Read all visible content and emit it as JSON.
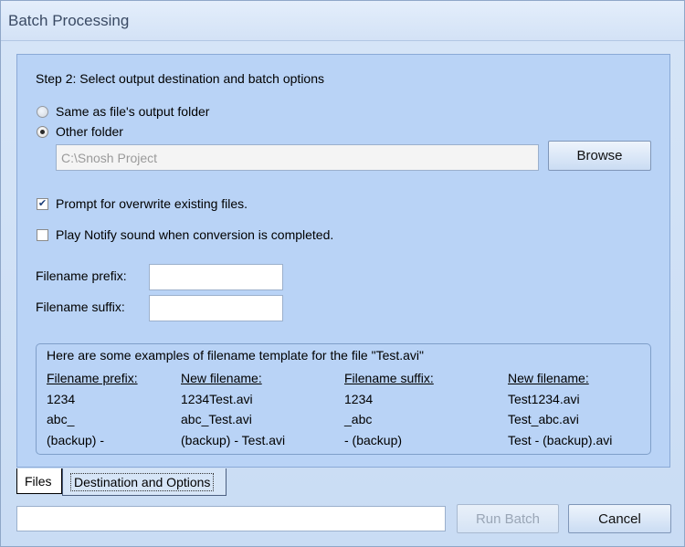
{
  "window": {
    "title": "Batch Processing"
  },
  "step_label": "Step 2: Select output destination and  batch options",
  "output": {
    "same_label": "Same as file's output folder",
    "other_label": "Other folder",
    "path_value": "C:\\Snosh Project",
    "browse_label": "Browse"
  },
  "options": {
    "prompt_overwrite_label": "Prompt for overwrite existing files.",
    "prompt_overwrite_checked": true,
    "notify_label": "Play Notify sound when conversion is completed.",
    "notify_checked": false
  },
  "filename": {
    "prefix_label": "Filename prefix:",
    "prefix_value": "",
    "suffix_label": "Filename suffix:",
    "suffix_value": ""
  },
  "examples": {
    "intro": "Here are some examples of filename template for the file \"Test.avi\"",
    "headers": [
      "Filename prefix:",
      "New filename:",
      "Filename suffix:",
      "New filename:"
    ],
    "rows": [
      [
        "1234",
        "1234Test.avi",
        "1234",
        "Test1234.avi"
      ],
      [
        "abc_",
        "abc_Test.avi",
        "_abc",
        "Test_abc.avi"
      ],
      [
        "(backup) -",
        "(backup) - Test.avi",
        "- (backup)",
        "Test - (backup).avi"
      ]
    ]
  },
  "tabs": [
    {
      "label": "Files"
    },
    {
      "label": "Destination and Options"
    }
  ],
  "footer": {
    "status_text": "",
    "run_batch_label": "Run Batch",
    "cancel_label": "Cancel"
  }
}
